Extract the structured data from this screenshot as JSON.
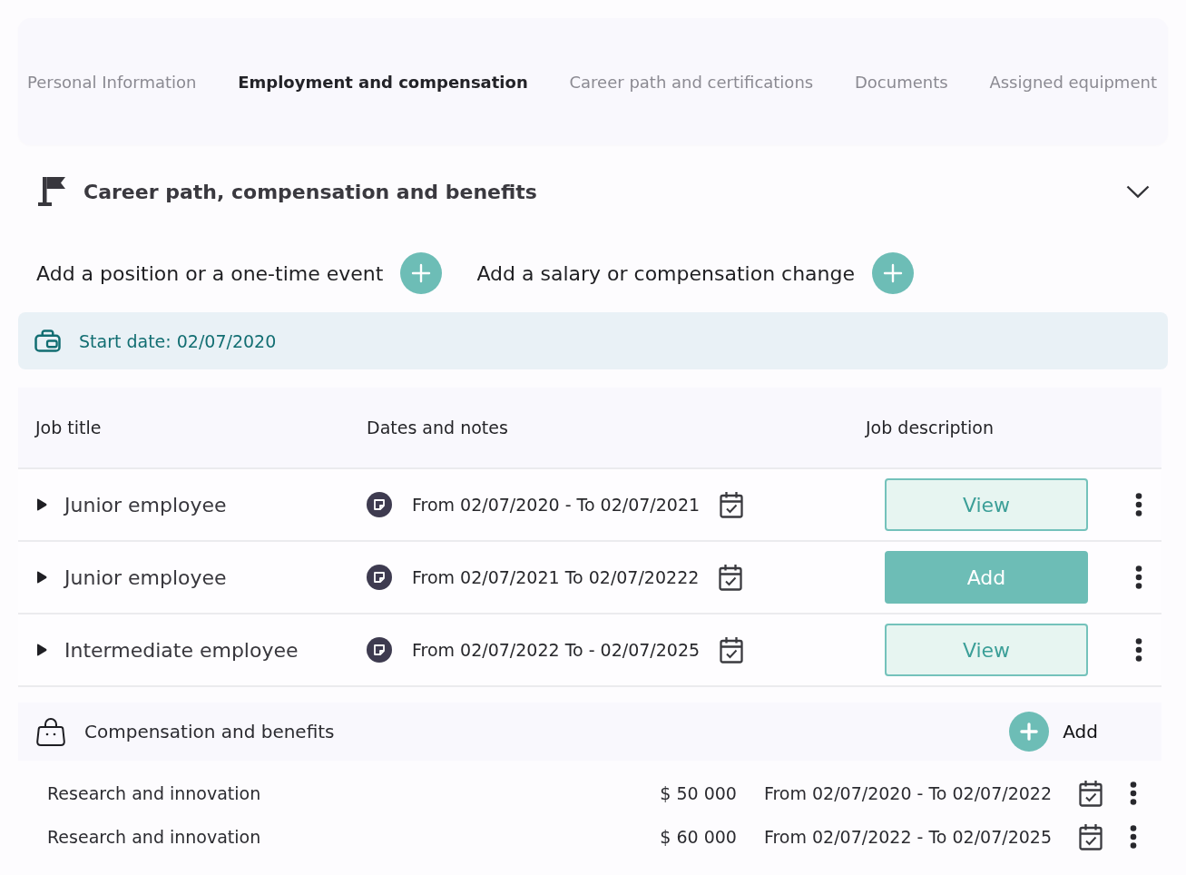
{
  "tabs": [
    {
      "label": "Personal Information",
      "selected": false
    },
    {
      "label": "Employment and compensation",
      "selected": true
    },
    {
      "label": "Career path and certifications",
      "selected": false
    },
    {
      "label": "Documents",
      "selected": false
    },
    {
      "label": "Assigned equipment",
      "selected": false
    }
  ],
  "section": {
    "title": "Career path, compensation and benefits",
    "expanded": true
  },
  "add_actions": [
    {
      "label": "Add a position or a one-time event"
    },
    {
      "label": "Add a salary or compensation change"
    }
  ],
  "start_date": "Start date: 02/07/2020",
  "positions_table": {
    "columns": [
      "Job title",
      "Dates and notes",
      "Job description"
    ],
    "rows": [
      {
        "title": "Junior employee",
        "expanded": false,
        "dates": "From 02/07/2020 - To 02/07/2021",
        "action": {
          "kind": "view",
          "label": "View"
        }
      },
      {
        "title": "Junior employee",
        "expanded": false,
        "dates": "From 02/07/2021 To 02/07/20222",
        "action": {
          "kind": "add",
          "label": "Add"
        }
      },
      {
        "title": "Intermediate employee",
        "expanded": false,
        "dates": "From 02/07/2022 To - 02/07/2025",
        "action": {
          "kind": "view",
          "label": "View"
        }
      }
    ]
  },
  "compensation": {
    "title": "Compensation and benefits",
    "add_label": "Add",
    "rows": [
      {
        "name": "Research and innovation",
        "amount": "$ 50 000",
        "dates": "From 02/07/2020 - To 02/07/2022"
      },
      {
        "name": "Research and innovation",
        "amount": "$ 60 000",
        "dates": "From 02/07/2022 - To 02/07/2025"
      }
    ]
  }
}
